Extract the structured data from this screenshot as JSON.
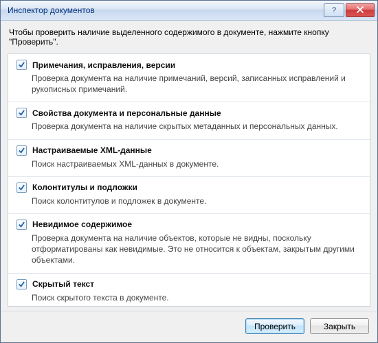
{
  "window": {
    "title": "Инспектор документов"
  },
  "instruction": "Чтобы проверить наличие выделенного содержимого в документе, нажмите кнопку \"Проверить\".",
  "options": [
    {
      "title": "Примечания, исправления, версии",
      "desc": "Проверка документа на наличие примечаний, версий, записанных исправлений и рукописных примечаний.",
      "checked": true
    },
    {
      "title": "Свойства документа и персональные данные",
      "desc": "Проверка документа на наличие скрытых метаданных и персональных данных.",
      "checked": true
    },
    {
      "title": "Настраиваемые XML-данные",
      "desc": "Поиск настраиваемых XML-данных в документе.",
      "checked": true
    },
    {
      "title": "Колонтитулы и подложки",
      "desc": "Поиск колонтитулов и подложек в документе.",
      "checked": true
    },
    {
      "title": "Невидимое содержимое",
      "desc": "Проверка документа на наличие объектов, которые не видны, поскольку отформатированы как невидимые. Это не относится к объектам, закрытым другими объектами.",
      "checked": true
    },
    {
      "title": "Скрытый текст",
      "desc": "Поиск скрытого текста в документе.",
      "checked": true
    }
  ],
  "buttons": {
    "inspect": "Проверить",
    "close": "Закрыть"
  }
}
